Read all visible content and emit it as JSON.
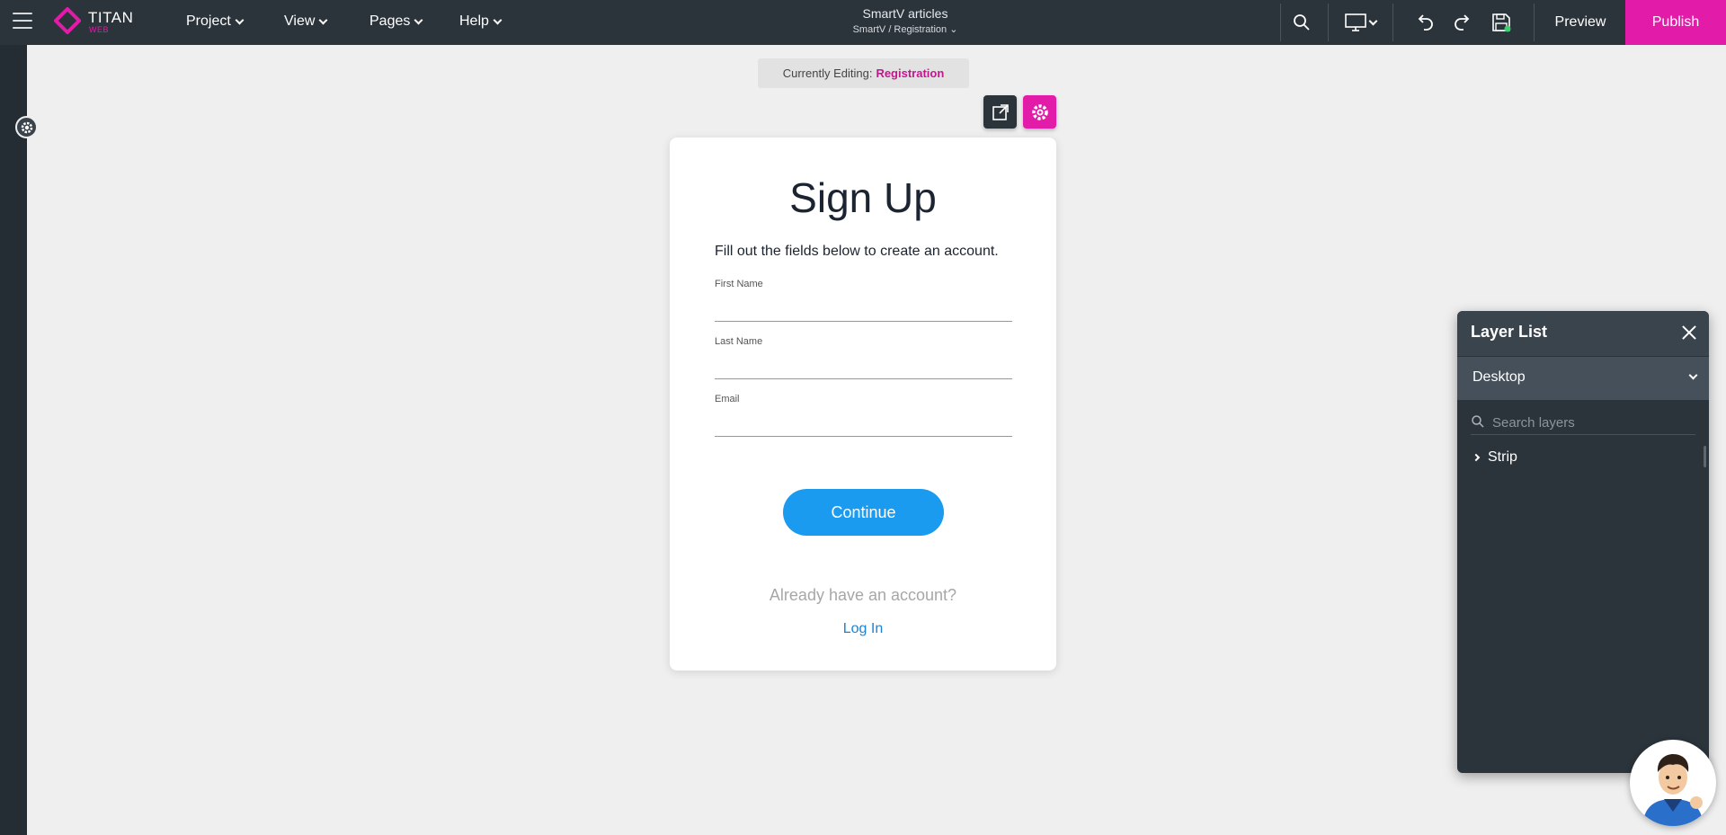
{
  "app": {
    "logo_title": "TITAN",
    "logo_sub": "WEB",
    "brand_color": "#e31ba9"
  },
  "menu": {
    "project": "Project",
    "view": "View",
    "pages": "Pages",
    "help": "Help"
  },
  "document": {
    "title": "SmartV articles",
    "path": "SmartV / Registration ⌄"
  },
  "toolbar": {
    "preview_label": "Preview",
    "publish_label": "Publish",
    "icons": [
      "search-icon",
      "desktop-device-icon",
      "undo-icon",
      "redo-icon",
      "save-icon"
    ]
  },
  "editing": {
    "prefix": "Currently Editing:",
    "page": "Registration"
  },
  "form": {
    "title": "Sign Up",
    "subtitle": "Fill out the fields below to create an account.",
    "fields": [
      {
        "label": "First Name",
        "value": ""
      },
      {
        "label": "Last Name",
        "value": ""
      },
      {
        "label": "Email",
        "value": ""
      }
    ],
    "continue_label": "Continue",
    "already_text": "Already have an account?",
    "login_label": "Log In",
    "button_color": "#1a9bf0"
  },
  "layers": {
    "title": "Layer List",
    "device": "Desktop",
    "search_placeholder": "Search layers",
    "items": [
      {
        "label": "Strip"
      }
    ]
  }
}
